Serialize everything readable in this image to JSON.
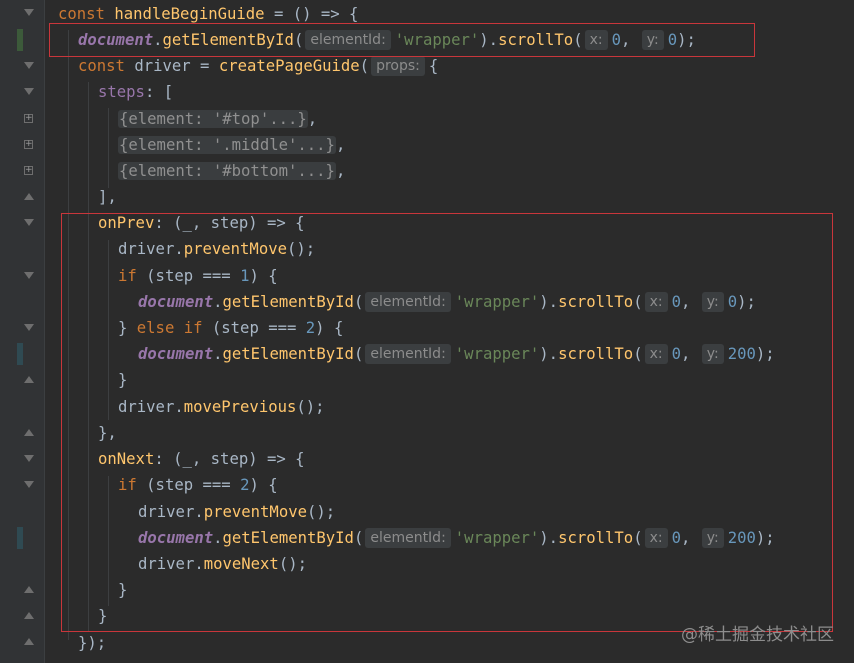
{
  "editor": {
    "watermark": "@稀土掘金技术社区",
    "colors": {
      "background": "#2b2b2b",
      "keyword": "#cc7832",
      "function": "#ffc66d",
      "property": "#9876aa",
      "string": "#6a8759",
      "number": "#6897bb",
      "highlight_box": "#c9363b"
    }
  },
  "code": {
    "l1": {
      "kw": "const",
      "name": "handleBeginGuide",
      "rest": " = () => {"
    },
    "l2": {
      "obj": "document",
      "method": "getElementById",
      "hint": "elementId:",
      "str": "'wrapper'",
      "method2": "scrollTo",
      "hx": "x:",
      "x": "0",
      "hy": "y:",
      "y": "0",
      "end": ");"
    },
    "l3": {
      "kw": "const",
      "name": " driver = ",
      "fn": "createPageGuide",
      "hint": "props:",
      "end": "{"
    },
    "l4": {
      "prop": "steps",
      "rest": ": ["
    },
    "l5": {
      "text": "{element: '#top'...}",
      "end": ","
    },
    "l6": {
      "text": "{element: '.middle'...}",
      "end": ","
    },
    "l7": {
      "text": "{element: '#bottom'...}",
      "end": ","
    },
    "l8": {
      "text": "],"
    },
    "l9": {
      "prop": "onPrev",
      "rest": ": (_, step) => {"
    },
    "l10": {
      "obj": "driver.",
      "fn": "preventMove",
      "end": "();"
    },
    "l11": {
      "kw": "if",
      "pre": " (step === ",
      "num": "1",
      "post": ") {"
    },
    "l12": {
      "obj": "document",
      "method": "getElementById",
      "hint": "elementId:",
      "str": "'wrapper'",
      "method2": "scrollTo",
      "hx": "x:",
      "x": "0",
      "hy": "y:",
      "y": "0",
      "end": ");"
    },
    "l13": {
      "pre": "} ",
      "kw": "else if",
      "mid": " (step === ",
      "num": "2",
      "post": ") {"
    },
    "l14": {
      "obj": "document",
      "method": "getElementById",
      "hint": "elementId:",
      "str": "'wrapper'",
      "method2": "scrollTo",
      "hx": "x:",
      "x": "0",
      "hy": "y:",
      "y": "200",
      "end": ");"
    },
    "l15": {
      "text": "}"
    },
    "l16": {
      "obj": "driver.",
      "fn": "movePrevious",
      "end": "();"
    },
    "l17": {
      "text": "},"
    },
    "l18": {
      "prop": "onNext",
      "rest": ": (_, step) => {"
    },
    "l19": {
      "kw": "if",
      "pre": " (step === ",
      "num": "2",
      "post": ") {"
    },
    "l20": {
      "obj": "driver.",
      "fn": "preventMove",
      "end": "();"
    },
    "l21": {
      "obj": "document",
      "method": "getElementById",
      "hint": "elementId:",
      "str": "'wrapper'",
      "method2": "scrollTo",
      "hx": "x:",
      "x": "0",
      "hy": "y:",
      "y": "200",
      "end": ");"
    },
    "l22": {
      "obj": "driver.",
      "fn": "moveNext",
      "end": "();"
    },
    "l23": {
      "text": "}"
    },
    "l24": {
      "text": "}"
    },
    "l25": {
      "text": "});"
    }
  }
}
